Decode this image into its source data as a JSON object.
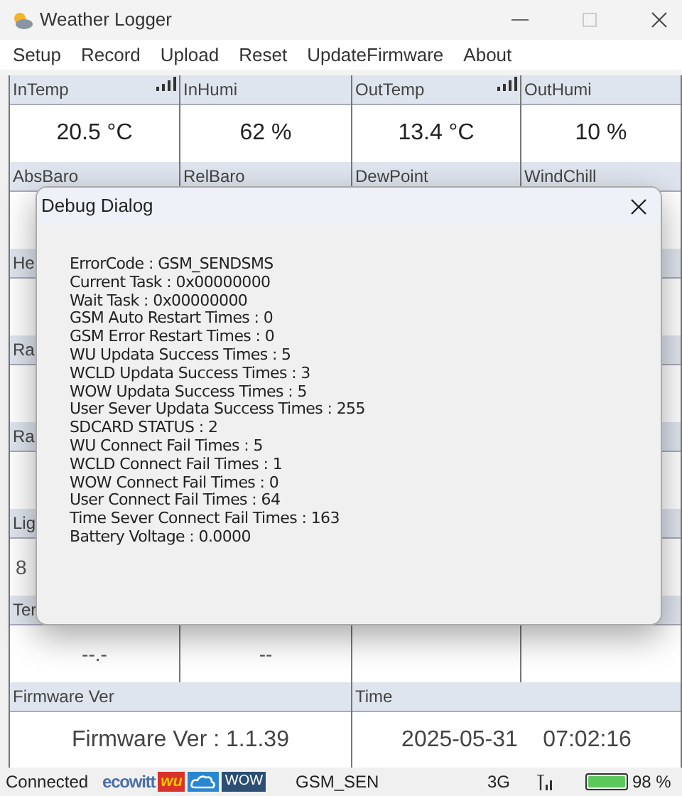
{
  "window": {
    "title": "Weather Logger"
  },
  "menu": [
    "Setup",
    "Record",
    "Upload",
    "Reset",
    "UpdateFirmware",
    "About"
  ],
  "grid_rows": [
    {
      "cells": [
        {
          "label": "InTemp",
          "signal": true,
          "value": "20.5 °C"
        },
        {
          "label": "InHumi",
          "signal": false,
          "value": "62 %"
        },
        {
          "label": "OutTemp",
          "signal": true,
          "value": "13.4 °C"
        },
        {
          "label": "OutHumi",
          "signal": false,
          "value": "10 %"
        }
      ]
    },
    {
      "cells": [
        {
          "label": "AbsBaro"
        },
        {
          "label": "RelBaro"
        },
        {
          "label": "DewPoint"
        },
        {
          "label": "WindChill"
        }
      ]
    },
    {
      "cells": [
        {
          "label": "He"
        }
      ]
    },
    {
      "cells": [
        {
          "label": "Ra"
        }
      ]
    },
    {
      "cells": [
        {
          "label": "Ra"
        }
      ]
    },
    {
      "cells": [
        {
          "label": "Lig",
          "value": "8"
        }
      ]
    },
    {
      "cells": [
        {
          "label": "Ter",
          "value": "--.-"
        },
        {
          "value": "--"
        }
      ]
    }
  ],
  "bottom_row": [
    {
      "label": "Firmware Ver",
      "value": "Firmware Ver : 1.1.39"
    },
    {
      "label": "Time",
      "value": "2025-05-31    07:02:16"
    }
  ],
  "dialog": {
    "title": "Debug Dialog",
    "lines": [
      "ErrorCode : GSM_SENDSMS",
      "Current Task : 0x00000000",
      "Wait Task : 0x00000000",
      "GSM Auto Restart Times : 0",
      "GSM Error Restart Times : 0",
      "WU Updata Success Times : 5",
      "WCLD Updata Success Times : 3",
      "WOW Updata Success Times : 5",
      "User Sever Updata Success Times : 255",
      "SDCARD STATUS : 2",
      "WU Connect Fail Times : 5",
      "WCLD Connect Fail Times : 1",
      "WOW Connect Fail Times : 0",
      "User Connect Fail Times : 64",
      "Time Sever Connect Fail Times : 163",
      "Battery Voltage : 0.0000"
    ]
  },
  "status_bar": {
    "connection": "Connected",
    "logos": [
      {
        "kind": "ecowitt",
        "text": "ecowitt"
      },
      {
        "kind": "wu",
        "text": "wu"
      },
      {
        "kind": "cloud"
      },
      {
        "kind": "wow",
        "text": "WOW"
      }
    ],
    "message": "GSM_SEN",
    "network": "3G",
    "battery": "98 %"
  }
}
